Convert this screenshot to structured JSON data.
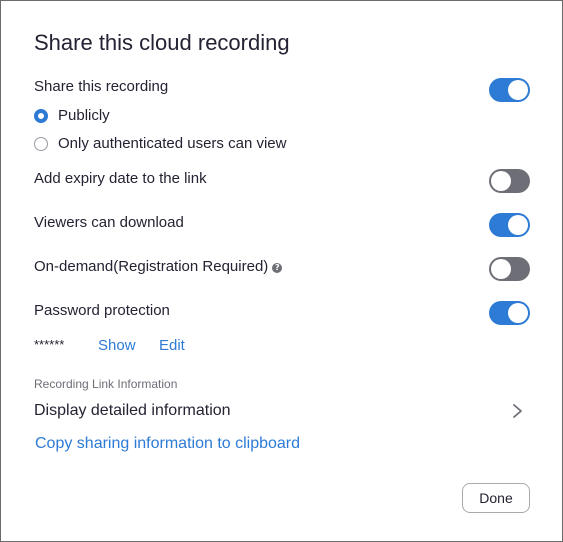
{
  "dialog": {
    "title": "Share this cloud recording"
  },
  "share_recording": {
    "label": "Share this recording",
    "enabled": true,
    "options": [
      {
        "label": "Publicly",
        "selected": true
      },
      {
        "label": "Only authenticated users can view",
        "selected": false
      }
    ]
  },
  "expiry": {
    "label": "Add expiry date to the link",
    "enabled": false
  },
  "download": {
    "label": "Viewers can download",
    "enabled": true
  },
  "on_demand": {
    "label": "On-demand(Registration Required)",
    "help_icon": "question-circle-icon",
    "enabled": false
  },
  "password": {
    "label": "Password protection",
    "enabled": true,
    "masked_value": "******",
    "show_label": "Show",
    "edit_label": "Edit"
  },
  "link_info": {
    "section_label": "Recording Link Information",
    "detail_label": "Display detailed information",
    "detail_icon": "chevron-right-icon",
    "copy_label": "Copy sharing information to clipboard"
  },
  "footer": {
    "done_label": "Done"
  },
  "colors": {
    "accent": "#2d7bd5",
    "toggle_off": "#6e6e77",
    "text": "#232333",
    "muted": "#6e6e77"
  }
}
